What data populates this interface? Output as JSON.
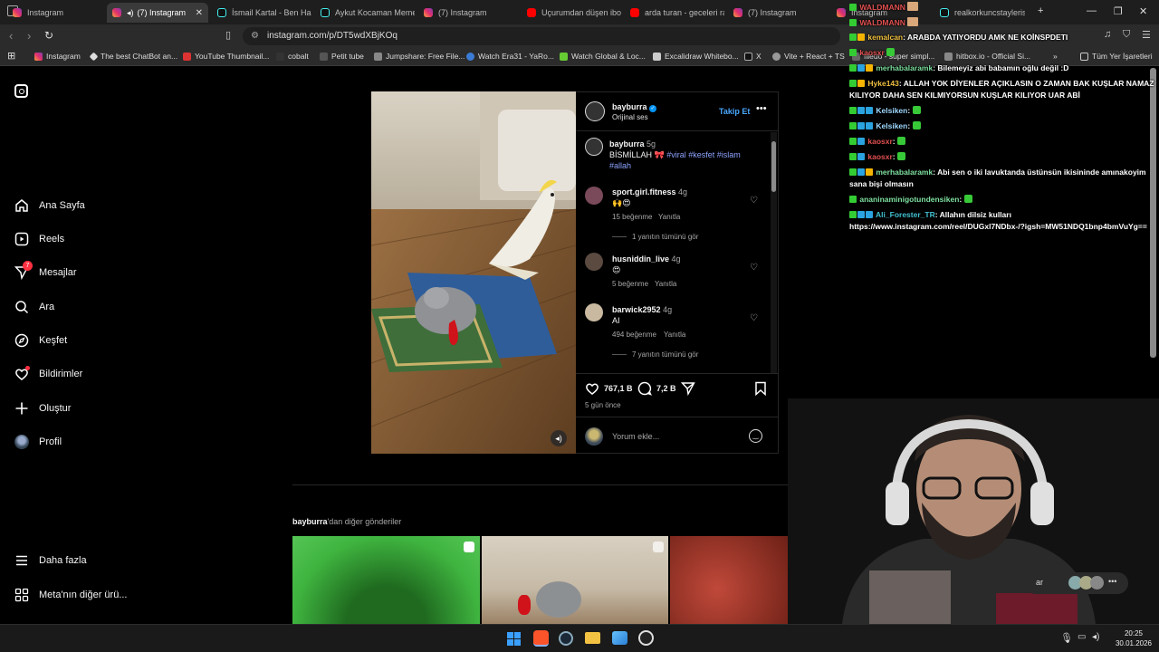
{
  "tabs": [
    {
      "label": "Instagram",
      "icon": "instagram-icon"
    },
    {
      "label": "(7) Instagram",
      "icon": "instagram-icon",
      "active": true
    },
    {
      "label": "İsmail Kartal - Ben Hala",
      "icon": "tiktok-icon"
    },
    {
      "label": "Aykut Kocaman Meme",
      "icon": "tiktok-icon"
    },
    {
      "label": "(7) Instagram",
      "icon": "instagram-icon"
    },
    {
      "label": "Uçurumdan düşen ibo",
      "icon": "youtube-icon"
    },
    {
      "label": "arda turan - geceleri ra",
      "icon": "youtube-icon"
    },
    {
      "label": "(7) Instagram",
      "icon": "instagram-icon"
    },
    {
      "label": "Instagram",
      "icon": "instagram-icon"
    },
    {
      "label": "realkorkuncstayleris",
      "icon": "tiktok-icon"
    }
  ],
  "address": {
    "url": "instagram.com/p/DT5wdXBjKOq"
  },
  "bookmarks": [
    "Instagram",
    "The best ChatBot an...",
    "YouTube Thumbnail...",
    "cobalt",
    "Petit tube",
    "Jumpshare: Free File...",
    "Watch Era31 - YaRo...",
    "Watch Global & Loc...",
    "Excalidraw Whitebo...",
    "X",
    "Vite + React + TS",
    "fileuo - super simpl...",
    "hitbox.io - Official Si...",
    "Tüm Yer İşaretleri"
  ],
  "sidebar": {
    "items": [
      {
        "label": "Ana Sayfa",
        "icon": "home-icon"
      },
      {
        "label": "Reels",
        "icon": "reels-icon"
      },
      {
        "label": "Mesajlar",
        "icon": "messages-icon",
        "badge": "7"
      },
      {
        "label": "Ara",
        "icon": "search-icon"
      },
      {
        "label": "Keşfet",
        "icon": "explore-icon"
      },
      {
        "label": "Bildirimler",
        "icon": "heart-icon"
      },
      {
        "label": "Oluştur",
        "icon": "plus-icon"
      },
      {
        "label": "Profil",
        "icon": "avatar"
      }
    ],
    "more": "Daha fazla",
    "meta": "Meta'nın diğer ürü..."
  },
  "post": {
    "username": "bayburra",
    "subtitle": "Orijinal ses",
    "follow": "Takip Et",
    "caption_user": "bayburra",
    "caption_age": "5g",
    "caption_text": "BİSMİLLAH 🎀",
    "caption_tags": "#viral #kesfet #islam #allah",
    "comments": [
      {
        "user": "sport.girl.fitness",
        "age": "4g",
        "text": "🙌😍",
        "likes": "15 beğenme",
        "reply": "Yanıtla",
        "view_replies": "1 yanıtın tümünü gör"
      },
      {
        "user": "husniddin_live",
        "age": "4g",
        "text": "😍",
        "likes": "5 beğenme",
        "reply": "Yanıtla",
        "view_replies": ""
      },
      {
        "user": "barwick2952",
        "age": "4g",
        "text": "AI",
        "likes": "494 beğenme",
        "reply": "Yanıtla",
        "view_replies": "7 yanıtın tümünü gör"
      }
    ],
    "like_count": "767,1 B",
    "comment_count": "7,2 B",
    "time_ago": "5 gün önce",
    "comment_placeholder": "Yorum ekle..."
  },
  "more_posts": {
    "prefix": "bayburra",
    "suffix": "'dan diğer gönderiler"
  },
  "chat": [
    {
      "user": "WALDMANN",
      "text": "",
      "color": "#e05050"
    },
    {
      "user": "WALDMANN",
      "text": "",
      "color": "#e05050"
    },
    {
      "user": "kemalcan",
      "text": ": ARABDA YATIYORDU AMK NE KOİNSPDETI",
      "color": "#f0c040"
    },
    {
      "user": "kaosxr",
      "text": "",
      "color": "#e05050"
    },
    {
      "user": "merhabalaramk",
      "text": ": Bilemeyiz abi babamın oğlu değil :D",
      "color": "#7fe0a0"
    },
    {
      "user": "Hyke143",
      "text": ": ALLAH YOK DİYENLER AÇIKLASIN O ZAMAN BAK KUŞLAR NAMAZ",
      "color": "#f0c040"
    },
    {
      "user": "",
      "text": "KILIYOR DAHA SEN KILMIYORSUN KUŞLAR KILIYOR UAR ABİ",
      "color": "#fff"
    },
    {
      "user": "Kelsiken",
      "text": ":",
      "color": "#9fd8ff"
    },
    {
      "user": "Kelsiken",
      "text": ":",
      "color": "#9fd8ff"
    },
    {
      "user": "kaosxr",
      "text": ":",
      "color": "#e05050"
    },
    {
      "user": "kaosxr",
      "text": ":",
      "color": "#e05050"
    },
    {
      "user": "merhabalaramk",
      "text": ": Abi sen o iki lavuktanda üstünsün ikisininde amınakoyim",
      "color": "#7fe0a0"
    },
    {
      "user": "",
      "text": "sana bişi olmasın",
      "color": "#fff"
    },
    {
      "user": "ananinaminigotundensiken",
      "text": ":",
      "color": "#7fe0a0"
    },
    {
      "user": "Ali_Forester_TR",
      "text": ": Allahın dilsiz kulları",
      "color": "#40c0d0"
    },
    {
      "user": "",
      "text": "https://www.instagram.com/reel/DUGxl7NDbx-/?igsh=MW51NDQ1bnp4bmVuYg==",
      "color": "#fff"
    }
  ],
  "taskbar": {
    "time": "20:25",
    "date": "30.01.2026"
  },
  "bubble_label": "ar"
}
